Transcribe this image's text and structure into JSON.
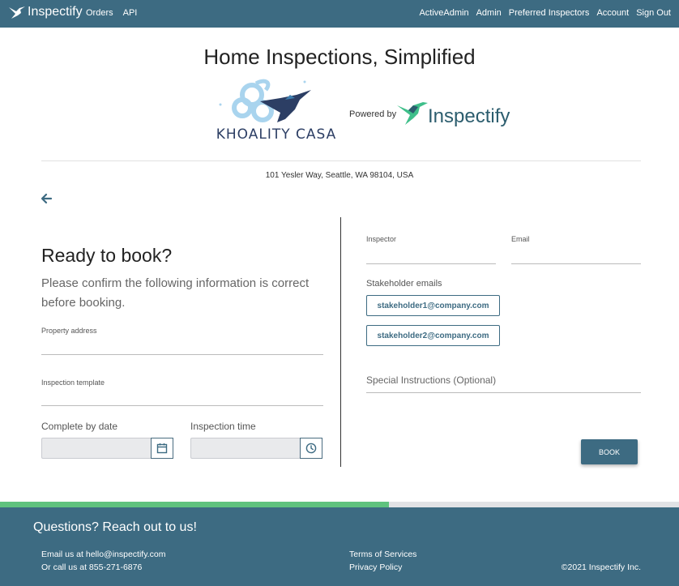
{
  "nav": {
    "brand": "Inspectify",
    "left_links": [
      "Orders",
      "API"
    ],
    "right_links": [
      "ActiveAdmin",
      "Admin",
      "Preferred Inspectors",
      "Account",
      "Sign Out"
    ]
  },
  "header": {
    "title": "Home Inspections, Simplified",
    "company_logo_text": "KHOALITY CASA",
    "powered_by": "Powered by",
    "inspectify_logo_text": "Inspectify"
  },
  "address": "101 Yesler Way, Seattle, WA 98104, USA",
  "left": {
    "title": "Ready to book?",
    "subtitle": "Please confirm the following information is correct before booking.",
    "property_address_label": "Property address",
    "property_address_value": "",
    "inspection_template_label": "Inspection template",
    "inspection_template_value": "",
    "complete_by_label": "Complete by date",
    "complete_by_value": "",
    "inspection_time_label": "Inspection time",
    "inspection_time_value": ""
  },
  "right": {
    "inspector_label": "Inspector",
    "inspector_value": "",
    "email_label": "Email",
    "email_value": "",
    "stakeholder_label": "Stakeholder emails",
    "stakeholders": [
      "stakeholder1@company.com",
      "stakeholder2@company.com"
    ],
    "special_instructions_placeholder": "Special Instructions (Optional)",
    "book_label": "BOOK"
  },
  "progress": 0.573,
  "footer": {
    "title": "Questions? Reach out to us!",
    "email_line": "Email us at hello@inspectify.com",
    "phone_line": "Or call us at 855-271-6876",
    "terms": "Terms of Services",
    "privacy": "Privacy Policy",
    "copyright": "©2021 Inspectify Inc."
  },
  "colors": {
    "primary": "#3d6b82",
    "progress": "#5fc27e",
    "kc_light_blue": "#a9d4ee",
    "kc_navy": "#2c3e64",
    "hummingbird_green": "#3fbf8a"
  }
}
